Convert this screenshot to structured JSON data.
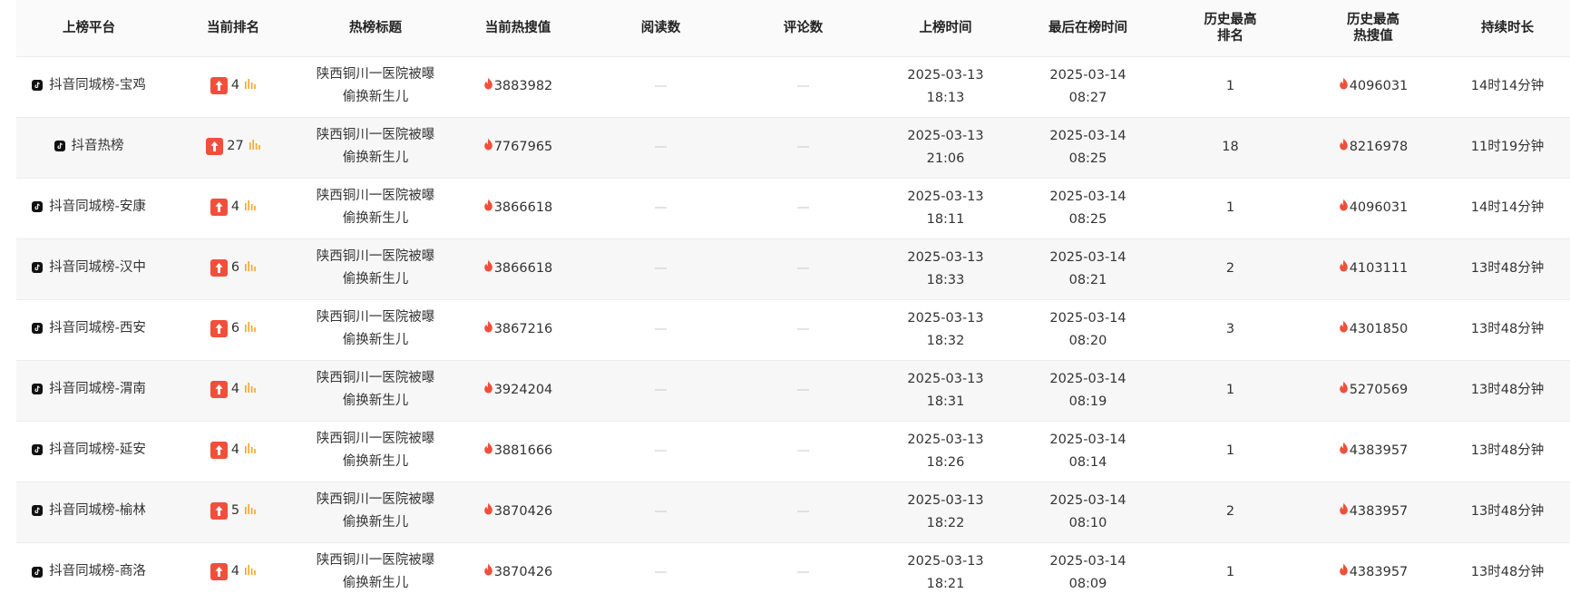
{
  "colors": {
    "rank_badge": "#f04f3c",
    "flame": "#f04f3c",
    "bars": "#f5a623",
    "row_stripe": "#f7f7f7"
  },
  "headers": {
    "platform": "上榜平台",
    "current_rank": "当前排名",
    "title": "热榜标题",
    "current_heat": "当前热搜值",
    "reads": "阅读数",
    "comments": "评论数",
    "on_time": "上榜时间",
    "last_time": "最后在榜时间",
    "best_rank_l1": "历史最高",
    "best_rank_l2": "排名",
    "best_heat_l1": "历史最高",
    "best_heat_l2": "热搜值",
    "duration": "持续时长"
  },
  "rows": [
    {
      "platform": "抖音同城榜-宝鸡",
      "rank": "4",
      "title": "陕西铜川一医院被曝偷换新生儿",
      "heat": "3883982",
      "reads": "—",
      "comments": "—",
      "on_date": "2025-03-13",
      "on_clock": "18:13",
      "last_date": "2025-03-14",
      "last_clock": "08:27",
      "best_rank": "1",
      "best_heat": "4096031",
      "duration": "14时14分钟"
    },
    {
      "platform": "抖音热榜",
      "rank": "27",
      "title": "陕西铜川一医院被曝偷换新生儿",
      "heat": "7767965",
      "reads": "—",
      "comments": "—",
      "on_date": "2025-03-13",
      "on_clock": "21:06",
      "last_date": "2025-03-14",
      "last_clock": "08:25",
      "best_rank": "18",
      "best_heat": "8216978",
      "duration": "11时19分钟"
    },
    {
      "platform": "抖音同城榜-安康",
      "rank": "4",
      "title": "陕西铜川一医院被曝偷换新生儿",
      "heat": "3866618",
      "reads": "—",
      "comments": "—",
      "on_date": "2025-03-13",
      "on_clock": "18:11",
      "last_date": "2025-03-14",
      "last_clock": "08:25",
      "best_rank": "1",
      "best_heat": "4096031",
      "duration": "14时14分钟"
    },
    {
      "platform": "抖音同城榜-汉中",
      "rank": "6",
      "title": "陕西铜川一医院被曝偷换新生儿",
      "heat": "3866618",
      "reads": "—",
      "comments": "—",
      "on_date": "2025-03-13",
      "on_clock": "18:33",
      "last_date": "2025-03-14",
      "last_clock": "08:21",
      "best_rank": "2",
      "best_heat": "4103111",
      "duration": "13时48分钟"
    },
    {
      "platform": "抖音同城榜-西安",
      "rank": "6",
      "title": "陕西铜川一医院被曝偷换新生儿",
      "heat": "3867216",
      "reads": "—",
      "comments": "—",
      "on_date": "2025-03-13",
      "on_clock": "18:32",
      "last_date": "2025-03-14",
      "last_clock": "08:20",
      "best_rank": "3",
      "best_heat": "4301850",
      "duration": "13时48分钟"
    },
    {
      "platform": "抖音同城榜-渭南",
      "rank": "4",
      "title": "陕西铜川一医院被曝偷换新生儿",
      "heat": "3924204",
      "reads": "—",
      "comments": "—",
      "on_date": "2025-03-13",
      "on_clock": "18:31",
      "last_date": "2025-03-14",
      "last_clock": "08:19",
      "best_rank": "1",
      "best_heat": "5270569",
      "duration": "13时48分钟"
    },
    {
      "platform": "抖音同城榜-延安",
      "rank": "4",
      "title": "陕西铜川一医院被曝偷换新生儿",
      "heat": "3881666",
      "reads": "—",
      "comments": "—",
      "on_date": "2025-03-13",
      "on_clock": "18:26",
      "last_date": "2025-03-14",
      "last_clock": "08:14",
      "best_rank": "1",
      "best_heat": "4383957",
      "duration": "13时48分钟"
    },
    {
      "platform": "抖音同城榜-榆林",
      "rank": "5",
      "title": "陕西铜川一医院被曝偷换新生儿",
      "heat": "3870426",
      "reads": "—",
      "comments": "—",
      "on_date": "2025-03-13",
      "on_clock": "18:22",
      "last_date": "2025-03-14",
      "last_clock": "08:10",
      "best_rank": "2",
      "best_heat": "4383957",
      "duration": "13时48分钟"
    },
    {
      "platform": "抖音同城榜-商洛",
      "rank": "4",
      "title": "陕西铜川一医院被曝偷换新生儿",
      "heat": "3870426",
      "reads": "—",
      "comments": "—",
      "on_date": "2025-03-13",
      "on_clock": "18:21",
      "last_date": "2025-03-14",
      "last_clock": "08:09",
      "best_rank": "1",
      "best_heat": "4383957",
      "duration": "13时48分钟"
    }
  ]
}
